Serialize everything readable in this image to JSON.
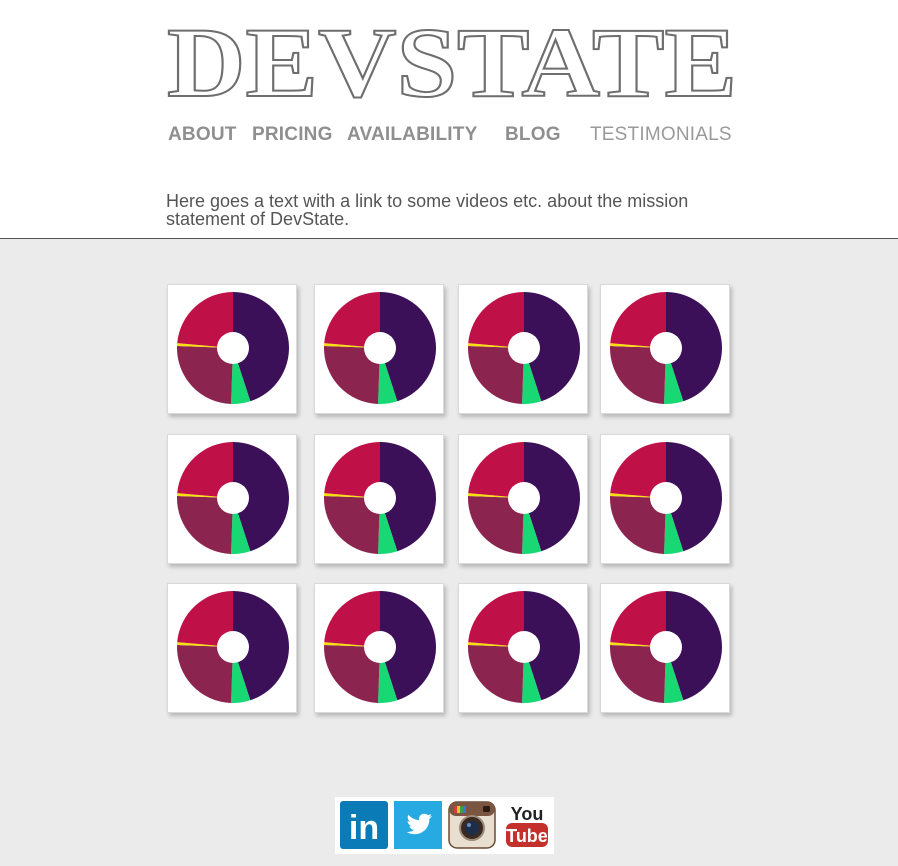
{
  "brand": {
    "logo_text": "DEVSTATE"
  },
  "nav": {
    "items": [
      {
        "label": "ABOUT"
      },
      {
        "label": "PRICING"
      },
      {
        "label": "AVAILABILITY"
      },
      {
        "label": "BLOG"
      },
      {
        "label": "TESTIMONIALS"
      }
    ]
  },
  "mission": {
    "text": "Here goes a text with a link to some videos etc. about the mission statement of DevState."
  },
  "colors": {
    "purple": "#3b1058",
    "crimson": "#c01048",
    "maroon": "#8c2450",
    "green": "#18d874",
    "yellow": "#f8e010"
  },
  "social": {
    "linkedin": "in",
    "twitter": "twitter-bird-icon",
    "instagram": "instagram-camera-icon",
    "youtube_top": "You",
    "youtube_bottom": "Tube"
  }
}
